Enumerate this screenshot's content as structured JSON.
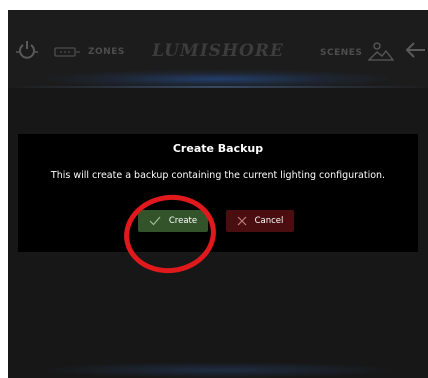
{
  "topbar": {
    "zones_label": "ZONES",
    "logo_text": "LUMISHORE",
    "scenes_label": "SCENES",
    "icons": [
      "power-icon",
      "zones-icon",
      "scenes-icon",
      "back-icon"
    ]
  },
  "dialog": {
    "title": "Create Backup",
    "message": "This will create a backup containing the current lighting configuration.",
    "create_label": "Create",
    "cancel_label": "Cancel"
  },
  "colors": {
    "screen_bg": "#171717",
    "dialog_bg": "#000000",
    "create_bg": "#33532a",
    "cancel_bg": "#4a0e10",
    "annotation": "#e0191d"
  }
}
